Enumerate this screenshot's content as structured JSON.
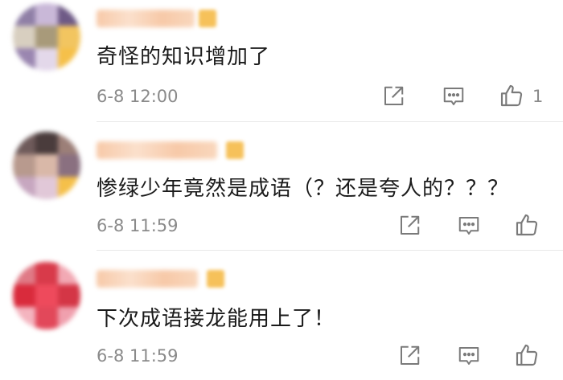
{
  "comments": [
    {
      "text": "奇怪的知识增加了",
      "time": "6-8 12:00",
      "like_count": "1",
      "avatar_icon": "blurred-avatar",
      "colors": {
        "avatar": [
          "#8f7fa6",
          "#c9b8d8",
          "#6e5a86",
          "#d8cfc0",
          "#a89a7a",
          "#f2c560",
          "#9a86b0",
          "#e3d8ea",
          "#f5c04a"
        ],
        "name": "#f7c9a8"
      }
    },
    {
      "text": "惨绿少年竟然是成语（？还是夸人的？？？",
      "time": "6-8 11:59",
      "like_count": "",
      "avatar_icon": "blurred-avatar",
      "colors": {
        "avatar": [
          "#6e5a5a",
          "#4a3c3c",
          "#9c7f78",
          "#b89a8e",
          "#d9b8a8",
          "#8a7080",
          "#c7a7c0",
          "#e1c8d8",
          "#f5c04a"
        ],
        "name": "#f7c9a8"
      }
    },
    {
      "text": "下次成语接龙能用上了！",
      "time": "6-8 11:59",
      "like_count": "",
      "avatar_icon": "blurred-avatar",
      "colors": {
        "avatar": [
          "#e07a86",
          "#d83a4a",
          "#f2a9b4",
          "#d92b3c",
          "#ee4a5c",
          "#d43646",
          "#f4b4bf",
          "#e2485a",
          "#f0a0ae"
        ],
        "name": "#f7c9a8"
      }
    }
  ],
  "icons": {
    "share": "share-icon",
    "reply": "comment-icon",
    "like": "thumbs-up-icon",
    "badge": "vip-badge"
  }
}
